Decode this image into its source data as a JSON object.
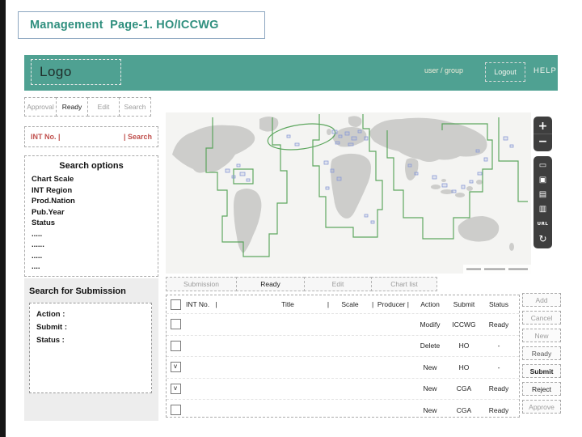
{
  "colors": {
    "accent_teal": "#4FA192",
    "title_teal": "#2F8F7E",
    "alert_red": "#C0504D",
    "map_green": "#4E9F50",
    "chart_outline_blue": "#8C9CD6",
    "control_panel_dark": "#3E3E3E"
  },
  "title": "Management  Page-1. HO/ICCWG",
  "header": {
    "logo": "Logo",
    "user_group": "user / group",
    "logout": "Logout",
    "help": "HELP"
  },
  "toolbar": {
    "buttons": [
      {
        "label": "Approval"
      },
      {
        "label": "Ready"
      },
      {
        "label": "Edit"
      },
      {
        "label": "Search"
      }
    ]
  },
  "int_search": {
    "left": "INT No. |",
    "right": "| Search"
  },
  "search_options": {
    "title": "Search options",
    "items": [
      "Chart Scale",
      "INT Region",
      "Prod.Nation",
      "Pub.Year",
      "Status",
      ".....",
      "......",
      ".....",
      "...."
    ]
  },
  "search_submission": {
    "title": "Search for Submission",
    "fields": [
      "Action :",
      "Submit :",
      "Status :"
    ]
  },
  "map": {
    "controls": [
      {
        "name": "zoom-in",
        "glyph": "+"
      },
      {
        "name": "zoom-out",
        "glyph": "−"
      },
      {
        "name": "extent",
        "glyph": "▭"
      },
      {
        "name": "layers",
        "glyph": "▣"
      },
      {
        "name": "print",
        "glyph": "▤"
      },
      {
        "name": "save",
        "glyph": "▥"
      },
      {
        "name": "url",
        "glyph": "URL"
      },
      {
        "name": "refresh",
        "glyph": "↻"
      }
    ]
  },
  "tabs": [
    {
      "label": "Submission"
    },
    {
      "label": "Ready"
    },
    {
      "label": "Edit"
    },
    {
      "label": "Chart list"
    }
  ],
  "table": {
    "headers": {
      "int_no": "INT No.   |",
      "title": "Title",
      "pipe": "|",
      "scale": "Scale",
      "producer": "|  Producer |",
      "action": "Action",
      "submit": "Submit",
      "status": "Status"
    },
    "rows": [
      {
        "checked": "",
        "action": "Modify",
        "submit": "ICCWG",
        "status": "Ready"
      },
      {
        "checked": "",
        "action": "Delete",
        "submit": "HO",
        "status": "-"
      },
      {
        "checked": "v",
        "action": "New",
        "submit": "HO",
        "status": "-"
      },
      {
        "checked": "v",
        "action": "New",
        "submit": "CGA",
        "status": "Ready"
      },
      {
        "checked": "",
        "action": "New",
        "submit": "CGA",
        "status": "Ready"
      }
    ]
  },
  "side_buttons": [
    {
      "label": "Add"
    },
    {
      "label": "Cancel"
    },
    {
      "label": "New"
    },
    {
      "label": "Ready"
    },
    {
      "label": "Submit"
    },
    {
      "label": "Reject"
    },
    {
      "label": "Approve"
    }
  ]
}
